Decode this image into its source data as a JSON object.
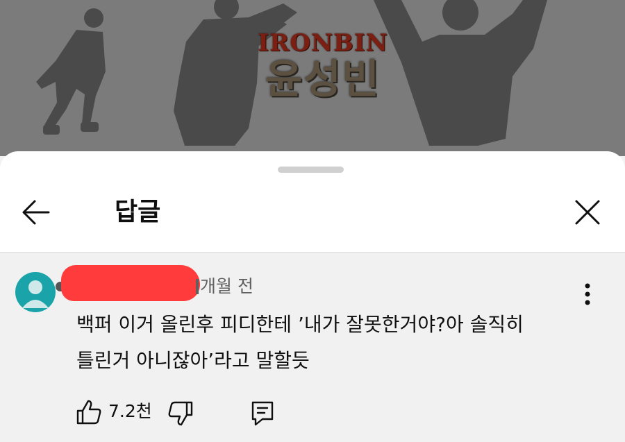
{
  "banner": {
    "logo_top": "IRONBIN",
    "logo_main": "윤성빈"
  },
  "header": {
    "title": "답글",
    "back_icon": "arrow-left-icon",
    "close_icon": "close-icon"
  },
  "comment": {
    "time": "개월 전",
    "text_line1": "백퍼 이거 올린후 피디한테 ’내가 잘못한거야?아 솔직히",
    "text_line2": "틀린거 아니잖아’라고 말할듯",
    "like_count": "7.2천",
    "avatar_color": "#1aa3a8",
    "redaction_color": "#ff3b3b"
  },
  "colors": {
    "sheet_bg": "#ffffff",
    "comment_bg": "#f1f1f1",
    "banner_dim": "#7b7b7b"
  }
}
